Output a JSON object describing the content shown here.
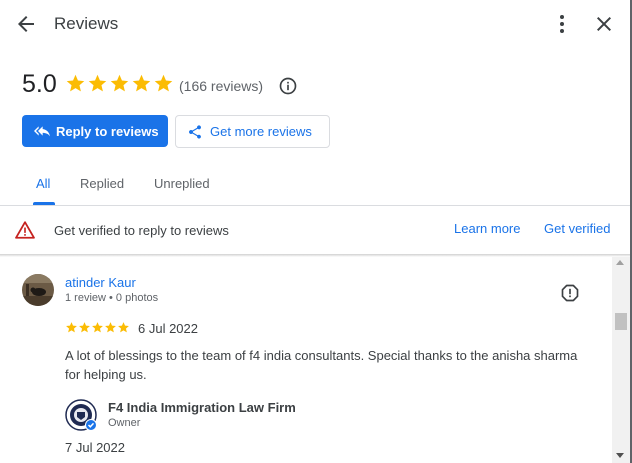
{
  "header": {
    "title": "Reviews",
    "back_icon": "arrow-left-icon",
    "more_icon": "more-vert-icon",
    "close_icon": "close-icon"
  },
  "summary": {
    "rating": "5.0",
    "stars": 5,
    "count_text": "(166 reviews)",
    "star_color": "#fbbc04"
  },
  "actions": {
    "reply_label": "Reply to reviews",
    "more_reviews_label": "Get more reviews"
  },
  "tabs": [
    {
      "label": "All",
      "active": true
    },
    {
      "label": "Replied",
      "active": false
    },
    {
      "label": "Unreplied",
      "active": false
    }
  ],
  "banner": {
    "text": "Get verified to reply to reviews",
    "learn_more": "Learn more",
    "get_verified": "Get verified",
    "warning_color": "#c5221f"
  },
  "review": {
    "name": "atinder Kaur",
    "meta": "1 review • 0 photos",
    "stars": 5,
    "date": "6 Jul 2022",
    "text": "A lot of blessings to the team of f4 india consultants. Special thanks to the anisha sharma for helping us."
  },
  "owner_reply": {
    "name": "F4 India Immigration Law Firm",
    "role": "Owner",
    "date": "7 Jul 2022"
  },
  "colors": {
    "accent": "#1a73e8",
    "text": "#202124",
    "muted": "#5f6368"
  }
}
